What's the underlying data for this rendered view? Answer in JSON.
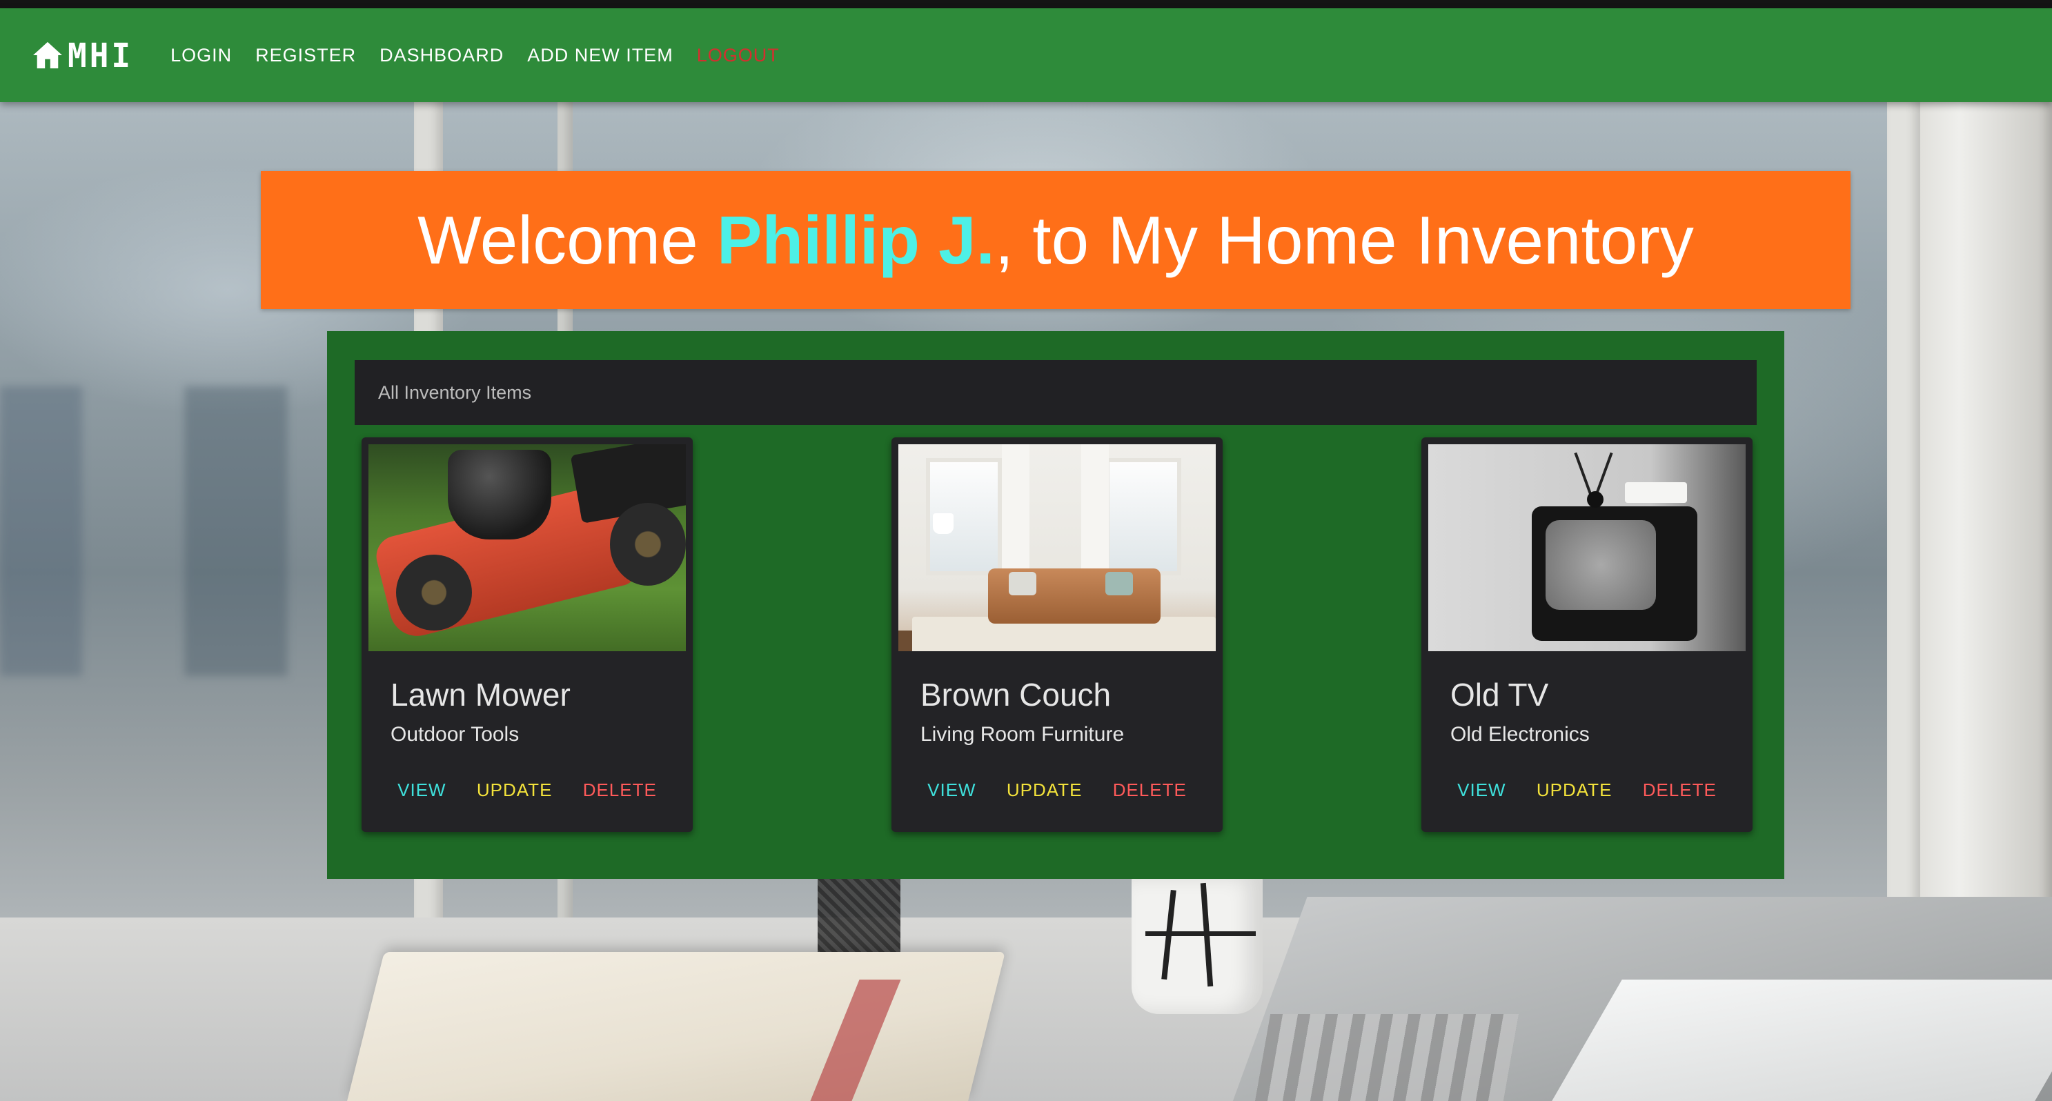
{
  "nav": {
    "brand": "MHI",
    "brand_icon": "home-icon",
    "links": {
      "login": "LOGIN",
      "register": "REGISTER",
      "dashboard": "DASHBOARD",
      "add_new_item": "ADD NEW ITEM",
      "logout": "LOGOUT"
    }
  },
  "banner": {
    "prefix": "Welcome ",
    "user_name": "Phillip J.",
    "suffix": ", to My Home Inventory"
  },
  "panel": {
    "header": "All Inventory Items"
  },
  "items": [
    {
      "title": "Lawn Mower",
      "category": "Outdoor Tools",
      "view": "VIEW",
      "update": "UPDATE",
      "delete": "DELETE"
    },
    {
      "title": "Brown Couch",
      "category": "Living Room Furniture",
      "view": "VIEW",
      "update": "UPDATE",
      "delete": "DELETE"
    },
    {
      "title": "Old TV",
      "category": "Old Electronics",
      "view": "VIEW",
      "update": "UPDATE",
      "delete": "DELETE"
    }
  ],
  "colors": {
    "navbar": "#2e8b3a",
    "banner": "#ff6f18",
    "banner_name": "#4df0e6",
    "panel": "#1e6a26",
    "card": "#232326",
    "action_view": "#3fe0dc",
    "action_update": "#f3e23b",
    "action_delete": "#ff5a5a",
    "logout": "#d32f2f"
  }
}
